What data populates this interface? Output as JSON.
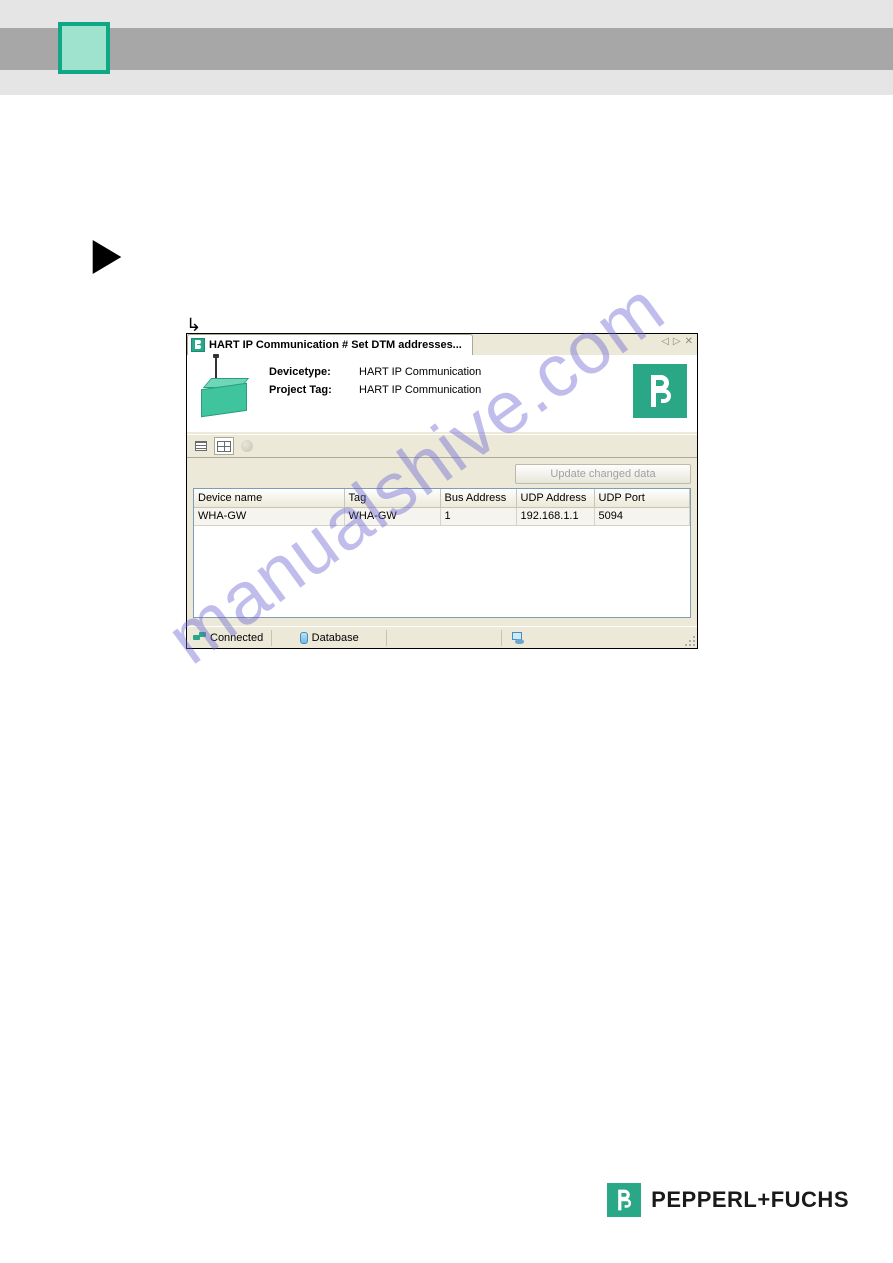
{
  "dialog": {
    "tab_title": "HART IP Communication # Set DTM addresses...",
    "tab_controls": {
      "prev": "◁",
      "next": "▷",
      "close": "✕"
    },
    "device_image_name": "wireless-gateway-illustration",
    "fields": {
      "devicetype_label": "Devicetype:",
      "devicetype_value": "HART IP Communication",
      "projecttag_label": "Project Tag:",
      "projecttag_value": "HART IP Communication"
    },
    "logo_alt": "Pepperl+Fuchs mark",
    "update_button": "Update changed data",
    "columns": {
      "device_name": "Device name",
      "tag": "Tag",
      "bus_address": "Bus Address",
      "udp_address": "UDP Address",
      "udp_port": "UDP Port"
    },
    "rows": [
      {
        "device_name": "WHA-GW",
        "tag": "WHA-GW",
        "bus_address": "1",
        "udp_address": "192.168.1.1",
        "udp_port": "5094"
      }
    ],
    "status": {
      "connected": "Connected",
      "database": "Database"
    }
  },
  "watermark": "manualshive.com",
  "footer_brand": "PEPPERL+FUCHS"
}
